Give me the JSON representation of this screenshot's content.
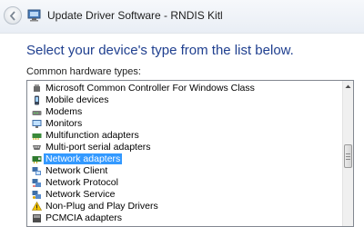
{
  "window": {
    "title": "Update Driver Software - RNDIS Kitl"
  },
  "page": {
    "heading": "Select your device's type from the list below.",
    "list_label": "Common hardware types:"
  },
  "hardware_types": [
    {
      "label": "Microsoft Common Controller For Windows Class",
      "icon": "usb-controller-icon",
      "selected": false
    },
    {
      "label": "Mobile devices",
      "icon": "mobile-device-icon",
      "selected": false
    },
    {
      "label": "Modems",
      "icon": "modem-icon",
      "selected": false
    },
    {
      "label": "Monitors",
      "icon": "monitor-icon",
      "selected": false
    },
    {
      "label": "Multifunction adapters",
      "icon": "multifunction-adapter-icon",
      "selected": false
    },
    {
      "label": "Multi-port serial adapters",
      "icon": "serial-port-icon",
      "selected": false
    },
    {
      "label": "Network adapters",
      "icon": "network-adapter-icon",
      "selected": true
    },
    {
      "label": "Network Client",
      "icon": "network-client-icon",
      "selected": false
    },
    {
      "label": "Network Protocol",
      "icon": "network-protocol-icon",
      "selected": false
    },
    {
      "label": "Network Service",
      "icon": "network-service-icon",
      "selected": false
    },
    {
      "label": "Non-Plug and Play Drivers",
      "icon": "non-pnp-driver-icon",
      "selected": false
    },
    {
      "label": "PCMCIA adapters",
      "icon": "pcmcia-adapter-icon",
      "selected": false
    }
  ],
  "colors": {
    "heading": "#1f3f8f",
    "selection": "#3399ff"
  }
}
